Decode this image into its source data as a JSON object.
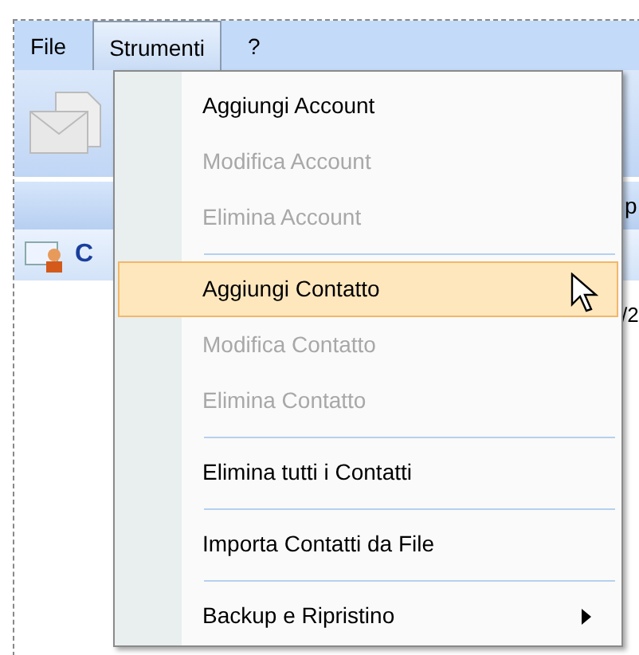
{
  "menu_bar": [
    {
      "label": "File",
      "selected": false
    },
    {
      "label": "Strumenti",
      "selected": true
    },
    {
      "label": "?",
      "selected": false
    }
  ],
  "panel": {
    "header_text": "C",
    "edge_texts": [
      "p",
      "/2"
    ]
  },
  "menu": [
    {
      "kind": "item",
      "label": "Aggiungi Account",
      "disabled": false,
      "selected": false,
      "submenu": false
    },
    {
      "kind": "item",
      "label": "Modifica Account",
      "disabled": true,
      "selected": false,
      "submenu": false
    },
    {
      "kind": "item",
      "label": "Elimina Account",
      "disabled": true,
      "selected": false,
      "submenu": false
    },
    {
      "kind": "separator"
    },
    {
      "kind": "item",
      "label": "Aggiungi Contatto",
      "disabled": false,
      "selected": true,
      "submenu": false
    },
    {
      "kind": "item",
      "label": "Modifica Contatto",
      "disabled": true,
      "selected": false,
      "submenu": false
    },
    {
      "kind": "item",
      "label": "Elimina Contatto",
      "disabled": true,
      "selected": false,
      "submenu": false
    },
    {
      "kind": "separator"
    },
    {
      "kind": "item",
      "label": "Elimina tutti i Contatti",
      "disabled": false,
      "selected": false,
      "submenu": false
    },
    {
      "kind": "separator"
    },
    {
      "kind": "item",
      "label": "Importa Contatti da File",
      "disabled": false,
      "selected": false,
      "submenu": false
    },
    {
      "kind": "separator"
    },
    {
      "kind": "item",
      "label": "Backup e Ripristino",
      "disabled": false,
      "selected": false,
      "submenu": true
    }
  ]
}
